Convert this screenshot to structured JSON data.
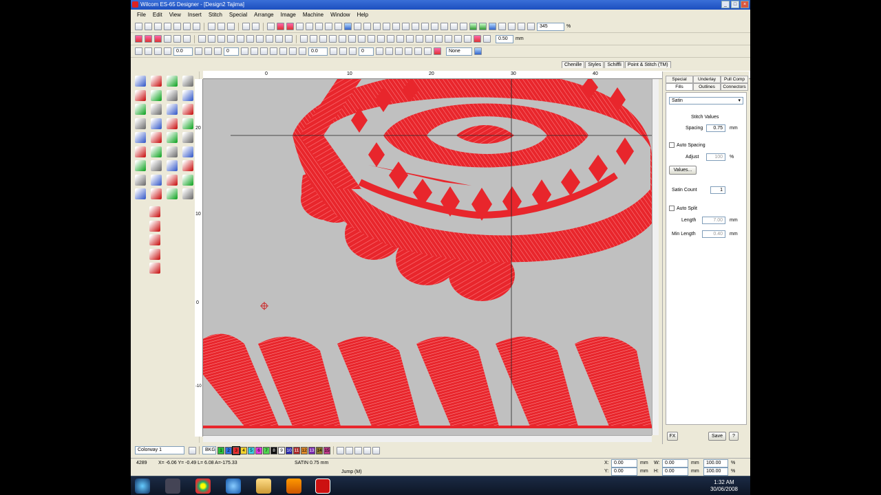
{
  "window": {
    "title": "Wilcom ES-65 Designer - [Design2    Tajima]",
    "controls": [
      "_",
      "□",
      "×"
    ]
  },
  "menu": [
    "File",
    "Edit",
    "View",
    "Insert",
    "Stitch",
    "Special",
    "Arrange",
    "Image",
    "Machine",
    "Window",
    "Help"
  ],
  "toolbar": {
    "zoom_value": "345",
    "zoom_unit": "%",
    "spacing_value": "0.50",
    "spacing_unit": "mm",
    "field_a": "0.0",
    "field_b": "0",
    "field_c": "0.0",
    "field_d": "0",
    "none_label": "None"
  },
  "docker_tabs_top": [
    "Chenille",
    "Styles",
    "Schiffli",
    "Point & Stitch (TM)"
  ],
  "ruler": {
    "top": [
      "0",
      "10",
      "20",
      "30",
      "40"
    ],
    "left": [
      "20",
      "10",
      "0",
      "-10"
    ]
  },
  "docker": {
    "tabs": [
      "Special",
      "Underlay",
      "Pull Comp",
      "Fills",
      "Outlines",
      "Connectors"
    ],
    "fill_type": "Satin",
    "stitch_values_label": "Stitch Values",
    "spacing_label": "Spacing",
    "spacing_value": "0.75",
    "unit_mm": "mm",
    "auto_spacing_label": "Auto Spacing",
    "adjust_label": "Adjust",
    "adjust_value": "100",
    "percent": "%",
    "values_button": "Values...",
    "satin_count_label": "Satin Count",
    "satin_count_value": "1",
    "auto_split_label": "Auto Split",
    "length_label": "Length",
    "length_value": "7.00",
    "min_length_label": "Min Length",
    "min_length_value": "0.40",
    "fx_button": "FX",
    "save_button": "Save",
    "help_button": "?"
  },
  "colorbar": {
    "colorway": "Colorway 1",
    "bkg": "BKG",
    "swatches": [
      {
        "label": "1",
        "color": "#2fbf3a"
      },
      {
        "label": "2",
        "color": "#2f6fe0"
      },
      {
        "label": "3",
        "color": "#e82c2c"
      },
      {
        "label": "4",
        "color": "#f3d32c"
      },
      {
        "label": "5",
        "color": "#3ad0e0"
      },
      {
        "label": "6",
        "color": "#e03ae0"
      },
      {
        "label": "7",
        "color": "#4fd44f"
      },
      {
        "label": "8",
        "color": "#111111"
      },
      {
        "label": "9",
        "color": "#ffffff"
      },
      {
        "label": "10",
        "color": "#2a2ab0"
      },
      {
        "label": "11",
        "color": "#b02a2a"
      },
      {
        "label": "12",
        "color": "#e08a2a"
      },
      {
        "label": "13",
        "color": "#7a2ab0"
      },
      {
        "label": "14",
        "color": "#8a7a2a"
      },
      {
        "label": "15",
        "color": "#c03a8a"
      }
    ],
    "current_swatch_index": 2
  },
  "status": {
    "stitch_count": "4289",
    "coords": "X= -6.06 Y= -0.49 L= 6.08 A=-175.33",
    "stitch_type": "SATIN  0.75 mm",
    "jump": "Jump (M)",
    "x_label": "X:",
    "y_label": "Y:",
    "w_label": "W:",
    "h_label": "H:",
    "x_value": "0.00",
    "y_value": "0.00",
    "w_value": "0.00",
    "h_value": "0.00",
    "unit": "mm",
    "pct_w": "100.00",
    "pct_h": "100.00",
    "pct": "%"
  },
  "taskbar": {
    "time": "1:32 AM",
    "date": "30/06/2008"
  },
  "design": {
    "thread_color": "#e8262c",
    "highlight_color": "#ff7a7e",
    "background_color": "#c0c0c0"
  }
}
